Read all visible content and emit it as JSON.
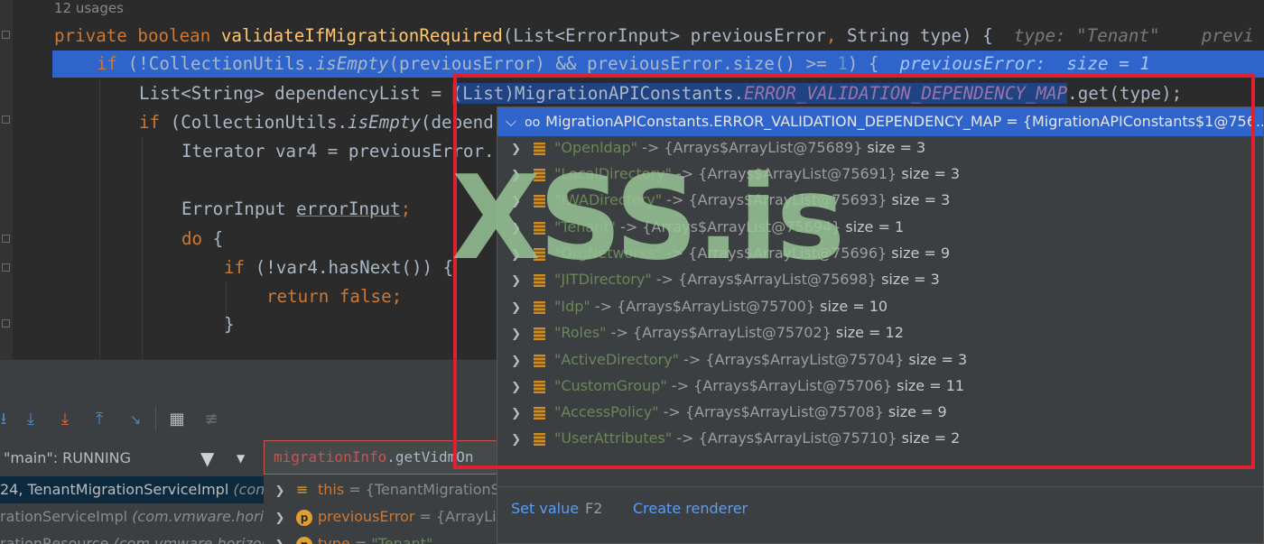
{
  "editor": {
    "usages": "12 usages",
    "line1": {
      "kw": "private boolean ",
      "fn": "validateIfMigrationRequired",
      "rest1": "(List<ErrorInput> previousError",
      "comma": ",",
      "rest2": " String type) {",
      "hint": "type: \"Tenant\"",
      "hint2": "previ"
    },
    "line2": {
      "kw": "if",
      "p1": " (!CollectionUtils.",
      "it1": "isEmpty",
      "p2": "(previousError) && previousError.size() >= ",
      "num": "1",
      "p3": ") {",
      "hint": "previousError:  size = 1"
    },
    "line3": {
      "p1": "List<String> dependencyList = ",
      "sel1": "(List)",
      "sel2": "MigrationAPIConstants.",
      "cn": "ERROR_VALIDATION_DEPENDENCY_MAP",
      "p2": ".get(type);"
    },
    "line4": {
      "kw": "if",
      "p1": " (CollectionUtils.",
      "it1": "isEmpty",
      "p2": "(depend"
    },
    "line5": {
      "p1": "Iterator var4 = previousError."
    },
    "line7": {
      "p1": "ErrorInput ",
      "ul": "errorInput",
      "kw": ";"
    },
    "line8": {
      "kw": "do",
      "p1": " {"
    },
    "line9": {
      "kw": "if",
      "p1": " (!var4.hasNext()) {"
    },
    "line10": {
      "kw": "return false;"
    },
    "line11": {
      "p1": "}"
    }
  },
  "debug": {
    "thread_label": "\"main\": RUNNING",
    "frames": [
      {
        "main": "24, TenantMigrationServiceImpl ",
        "pkg": "(com.v"
      },
      {
        "main": "rationServiceImpl ",
        "pkg": "(com.vmware.horizo"
      },
      {
        "main": "rationResource ",
        "pkg": "(com.vmware.horizon.n"
      }
    ],
    "eval_expr": {
      "a": "migrationInfo",
      "b": ".getVidmOn"
    },
    "variables": [
      {
        "badge": "",
        "name": "this",
        "eq": " = ",
        "val": "{TenantMigrationSe"
      },
      {
        "badge": "p",
        "name": "previousError",
        "eq": " = ",
        "val": "{ArrayList"
      },
      {
        "badge": "p",
        "name": "type",
        "eq": " = ",
        "val": "\"Tenant\""
      }
    ]
  },
  "popup": {
    "header": "MigrationAPIConstants.ERROR_VALIDATION_DEPENDENCY_MAP = {MigrationAPIConstants$1@756...",
    "entries": [
      {
        "key": "\"Openldap\"",
        "arrow": " -> ",
        "ref": "{Arrays$ArrayList@75689}",
        "size": "size = 3"
      },
      {
        "key": "\"LocalDirectory\"",
        "arrow": " -> ",
        "ref": "{Arrays$ArrayList@75691}",
        "size": "size = 3"
      },
      {
        "key": "\"IWADirectory\"",
        "arrow": " -> ",
        "ref": "{Arrays$ArrayList@75693}",
        "size": "size = 3"
      },
      {
        "key": "\"Tenant\"",
        "arrow": " -> ",
        "ref": "{Arrays$ArrayList@75694}",
        "size": "size = 1"
      },
      {
        "key": "\"OrgNetworks\"",
        "arrow": " -> ",
        "ref": "{Arrays$ArrayList@75696}",
        "size": "size = 9"
      },
      {
        "key": "\"JITDirectory\"",
        "arrow": " -> ",
        "ref": "{Arrays$ArrayList@75698}",
        "size": "size = 3"
      },
      {
        "key": "\"Idp\"",
        "arrow": " -> ",
        "ref": "{Arrays$ArrayList@75700}",
        "size": "size = 10"
      },
      {
        "key": "\"Roles\"",
        "arrow": " -> ",
        "ref": "{Arrays$ArrayList@75702}",
        "size": "size = 12"
      },
      {
        "key": "\"ActiveDirectory\"",
        "arrow": " -> ",
        "ref": "{Arrays$ArrayList@75704}",
        "size": "size = 3"
      },
      {
        "key": "\"CustomGroup\"",
        "arrow": " -> ",
        "ref": "{Arrays$ArrayList@75706}",
        "size": "size = 11"
      },
      {
        "key": "\"AccessPolicy\"",
        "arrow": " -> ",
        "ref": "{Arrays$ArrayList@75708}",
        "size": "size = 9"
      },
      {
        "key": "\"UserAttributes\"",
        "arrow": " -> ",
        "ref": "{Arrays$ArrayList@75710}",
        "size": "size = 2"
      }
    ],
    "set_value_label": "Set value",
    "set_value_key": "F2",
    "create_renderer_label": "Create renderer"
  },
  "watermark": "XSS.is",
  "colors": {
    "selection": "#2f65ca",
    "keyword": "#cc7832",
    "method": "#ffc66d",
    "string": "#6a8759",
    "constant": "#9876aa",
    "highlight_box": "#e0202e",
    "watermark": "#98c496"
  }
}
